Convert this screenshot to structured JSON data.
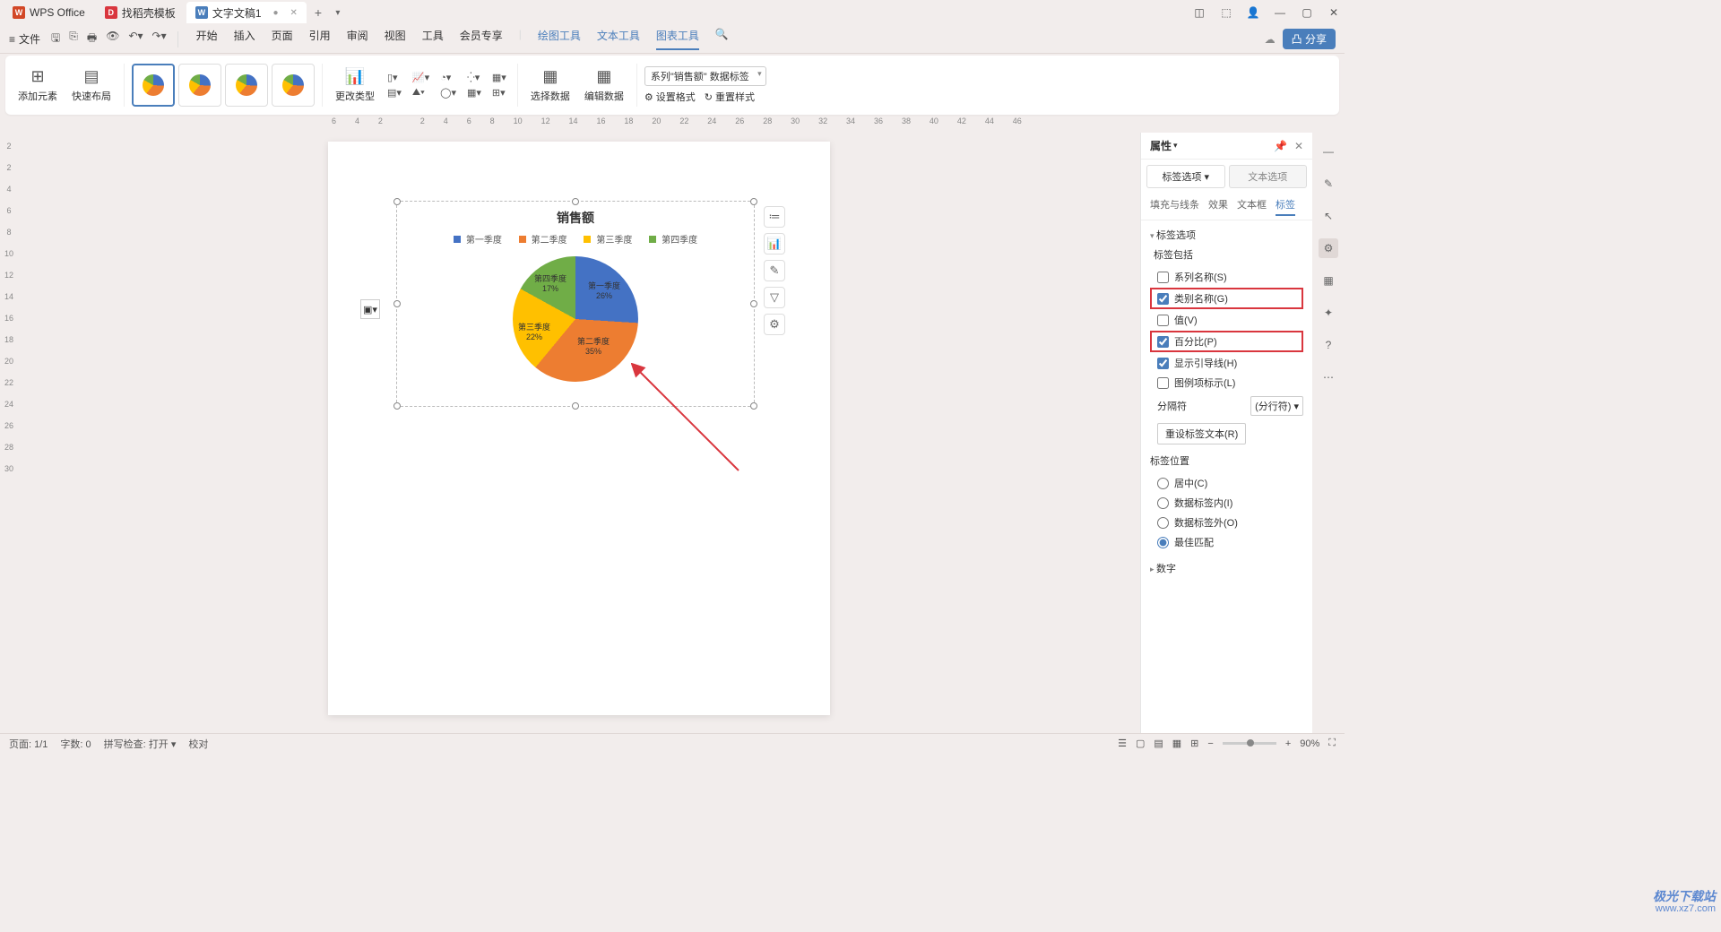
{
  "titlebar": {
    "app": "WPS Office",
    "tabs": [
      {
        "icon": "D",
        "label": "找稻壳模板"
      },
      {
        "icon": "W",
        "label": "文字文稿1",
        "active": true
      }
    ]
  },
  "menubar": {
    "file": "文件",
    "tabs": [
      "开始",
      "插入",
      "页面",
      "引用",
      "审阅",
      "视图",
      "工具",
      "会员专享"
    ],
    "toolTabs": [
      "绘图工具",
      "文本工具",
      "图表工具"
    ],
    "share": "分享"
  },
  "ribbon": {
    "addElement": "添加元素",
    "quickLayout": "快速布局",
    "changeType": "更改类型",
    "selectData": "选择数据",
    "editData": "编辑数据",
    "setFormat": "设置格式",
    "resetStyle": "重置样式",
    "seriesDropdown": "系列\"销售额\" 数据标签"
  },
  "ruler": {
    "hTicks": [
      "6",
      "4",
      "2",
      "",
      "2",
      "4",
      "6",
      "8",
      "10",
      "12",
      "14",
      "16",
      "18",
      "20",
      "22",
      "24",
      "26",
      "28",
      "30",
      "32",
      "34",
      "36",
      "38",
      "40",
      "42",
      "44",
      "46"
    ],
    "vTicks": [
      "",
      "2",
      "2",
      "4",
      "6",
      "8",
      "10",
      "12",
      "14",
      "16",
      "18",
      "20",
      "22",
      "24",
      "26",
      "28",
      "30"
    ]
  },
  "chart_data": {
    "type": "pie",
    "title": "销售额",
    "categories": [
      "第一季度",
      "第二季度",
      "第三季度",
      "第四季度"
    ],
    "values": [
      26,
      35,
      22,
      17
    ],
    "labels": [
      "第一季度\n26%",
      "第二季度\n35%",
      "第三季度\n22%",
      "第四季度\n17%"
    ],
    "colors": [
      "#4472c4",
      "#ed7d31",
      "#ffc000",
      "#70ad47"
    ]
  },
  "panel": {
    "title": "属性",
    "tabLabel": "标签选项",
    "tabText": "文本选项",
    "subtabs": [
      "填充与线条",
      "效果",
      "文本框",
      "标签"
    ],
    "secLabelOptions": "标签选项",
    "secLabelIncludes": "标签包括",
    "chkSeriesName": "系列名称(S)",
    "chkCategoryName": "类别名称(G)",
    "chkValue": "值(V)",
    "chkPercent": "百分比(P)",
    "chkLeaderLines": "显示引导线(H)",
    "chkLegendKey": "图例项标示(L)",
    "separator": "分隔符",
    "separatorValue": "(分行符)",
    "resetLabel": "重设标签文本(R)",
    "secLabelPos": "标签位置",
    "radCenter": "居中(C)",
    "radInside": "数据标签内(I)",
    "radOutside": "数据标签外(O)",
    "radBestFit": "最佳匹配",
    "secNumber": "数字"
  },
  "statusbar": {
    "page": "页面: 1/1",
    "words": "字数: 0",
    "spell": "拼写检查: 打开",
    "proof": "校对",
    "zoom": "90%"
  },
  "watermark": {
    "brand": "极光下载站",
    "url": "www.xz7.com"
  }
}
